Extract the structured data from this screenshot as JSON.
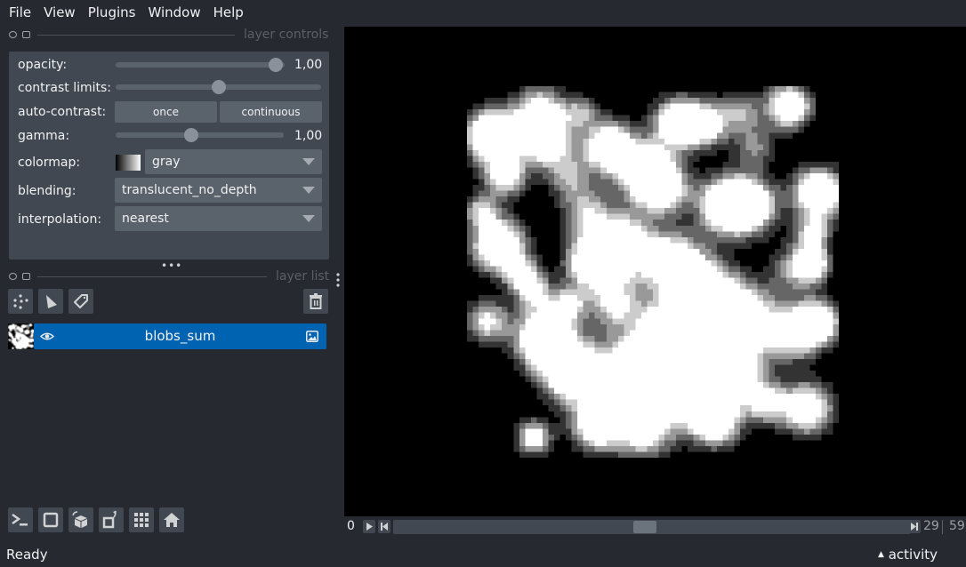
{
  "menu": [
    "File",
    "View",
    "Plugins",
    "Window",
    "Help"
  ],
  "layer_controls": {
    "title": "layer controls",
    "opacity": {
      "label": "opacity:",
      "value": "1,00",
      "fraction": 1.0
    },
    "contrast_limits": {
      "label": "contrast limits:",
      "low_fraction": 0.0,
      "high_fraction": 0.5
    },
    "auto_contrast": {
      "label": "auto-contrast:",
      "once": "once",
      "continuous": "continuous"
    },
    "gamma": {
      "label": "gamma:",
      "value": "1,00",
      "fraction": 0.45
    },
    "colormap": {
      "label": "colormap:",
      "value": "gray"
    },
    "blending": {
      "label": "blending:",
      "value": "translucent_no_depth"
    },
    "interpolation": {
      "label": "interpolation:",
      "value": "nearest"
    }
  },
  "layer_list": {
    "title": "layer list",
    "layers": [
      {
        "name": "blobs_sum",
        "visible": true,
        "type": "image"
      }
    ]
  },
  "dims": {
    "current": "0",
    "slider_value": "29",
    "max": "59",
    "fraction": 0.49
  },
  "status": {
    "text": "Ready",
    "activity": "activity"
  },
  "colors": {
    "accent": "#0063b1",
    "bg": "#262930",
    "panel": "#414851"
  }
}
